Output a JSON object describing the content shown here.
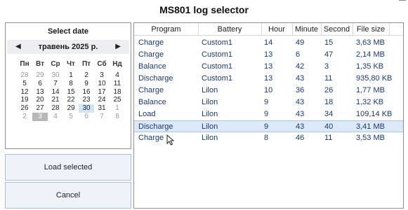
{
  "window": {
    "title": "MS801 log selector"
  },
  "calendar": {
    "title": "Select date",
    "month_label": "травень 2025 р.",
    "nav_prev": "◀",
    "nav_next": "▶",
    "weekdays": [
      "Пн",
      "Вт",
      "Ср",
      "Чт",
      "Пт",
      "Сб",
      "Нд"
    ],
    "weeks": [
      [
        "28",
        "29",
        "30",
        "1",
        "2",
        "3",
        "4"
      ],
      [
        "5",
        "6",
        "7",
        "8",
        "9",
        "10",
        "11"
      ],
      [
        "12",
        "13",
        "14",
        "15",
        "16",
        "17",
        "18"
      ],
      [
        "19",
        "20",
        "21",
        "22",
        "23",
        "24",
        "25"
      ],
      [
        "26",
        "27",
        "28",
        "29",
        "30",
        "31",
        "1"
      ],
      [
        "2",
        "3",
        "4",
        "5",
        "6",
        "7",
        "8"
      ]
    ],
    "selected_day": "3",
    "today_day": "30"
  },
  "buttons": {
    "load": "Load selected",
    "cancel": "Cancel"
  },
  "table": {
    "columns": [
      "Program",
      "Battery",
      "Hour",
      "Minute",
      "Second",
      "File size"
    ],
    "rows": [
      [
        "Charge",
        "Custom1",
        "14",
        "49",
        "15",
        "3,63 MB"
      ],
      [
        "Charge",
        "Custom1",
        "13",
        "6",
        "47",
        "2,14 MB"
      ],
      [
        "Balance",
        "Custom1",
        "13",
        "42",
        "3",
        "1,35 KB"
      ],
      [
        "Discharge",
        "Custom1",
        "13",
        "43",
        "11",
        "935,80 KB"
      ],
      [
        "Charge",
        "Lilon",
        "10",
        "36",
        "26",
        "1,77 MB"
      ],
      [
        "Balance",
        "Lilon",
        "9",
        "43",
        "18",
        "1,32 KB"
      ],
      [
        "Load",
        "Lilon",
        "9",
        "43",
        "34",
        "109,14 KB"
      ],
      [
        "Discharge",
        "Lilon",
        "9",
        "43",
        "40",
        "3,41 MB"
      ],
      [
        "Charge",
        "Lilon",
        "8",
        "46",
        "11",
        "3,53 MB"
      ]
    ],
    "selected_row": 7
  },
  "colors": {
    "row_text": "#1a3a6b",
    "selected_row_bg": "#dbe9f8",
    "button_bg": "#eef3fa"
  }
}
